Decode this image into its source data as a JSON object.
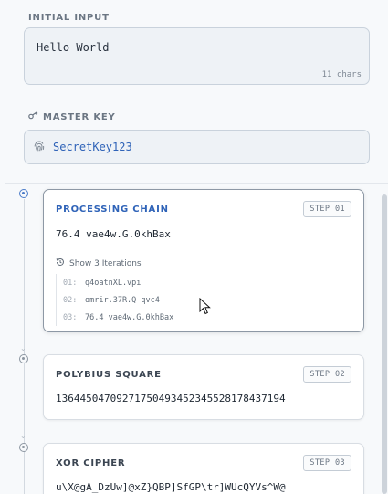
{
  "initial_input": {
    "label": "INITIAL INPUT",
    "value": "Hello World",
    "char_count": "11 chars"
  },
  "master_key": {
    "label": "MASTER KEY",
    "value": "SecretKey123",
    "label_icon": "key-icon",
    "field_icon": "fingerprint-icon"
  },
  "steps": [
    {
      "title": "PROCESSING CHAIN",
      "badge": "STEP 01",
      "output": "76.4 vae4w.G.0khBax",
      "iterations_label": "Show 3 Iterations",
      "iterations": [
        {
          "num": "01:",
          "text": "q4oatnXL.vpi"
        },
        {
          "num": "02:",
          "text": "omrir.37R.Q qvc4"
        },
        {
          "num": "03:",
          "text": "76.4 vae4w.G.0khBax"
        }
      ]
    },
    {
      "title": "POLYBIUS SQUARE",
      "badge": "STEP 02",
      "output": "13644504709271750493452345528178437194"
    },
    {
      "title": "XOR CIPHER",
      "badge": "STEP 03",
      "output": "u\\X@gA_DzUw]@xZ}QBP]SfGP\\tr]WUcQYVs^W@"
    }
  ],
  "colors": {
    "accent": "#2f63b8",
    "active_border": "#8d98a5",
    "field_bg": "#eef2f6"
  }
}
